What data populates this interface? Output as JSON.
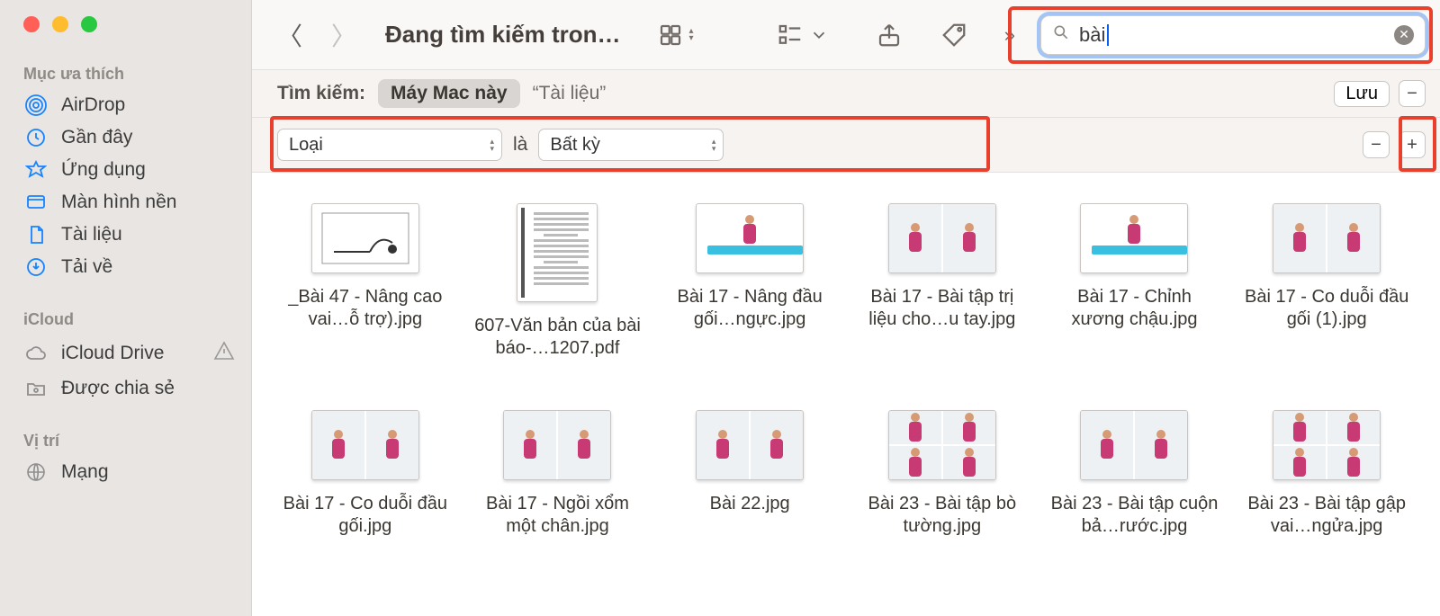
{
  "sidebar": {
    "sections": {
      "favorites": {
        "header": "Mục ưa thích",
        "items": [
          {
            "label": "AirDrop"
          },
          {
            "label": "Gần đây"
          },
          {
            "label": "Ứng dụng"
          },
          {
            "label": "Màn hình nền"
          },
          {
            "label": "Tài liệu"
          },
          {
            "label": "Tải về"
          }
        ]
      },
      "icloud": {
        "header": "iCloud",
        "items": [
          {
            "label": "iCloud Drive"
          },
          {
            "label": "Được chia sẻ"
          }
        ]
      },
      "locations": {
        "header": "Vị trí",
        "items": [
          {
            "label": "Mạng"
          }
        ]
      }
    }
  },
  "toolbar": {
    "title": "Đang tìm kiếm tron…",
    "search_value": "bài"
  },
  "scope": {
    "label": "Tìm kiếm:",
    "selected": "Máy Mac này",
    "alt": "“Tài liệu”",
    "save": "Lưu"
  },
  "criteria": {
    "kind_label": "Loại",
    "is_label": "là",
    "value_label": "Bất kỳ"
  },
  "files": [
    {
      "name": "_Bài 47 - Nâng cao vai…ỗ trợ).jpg",
      "thumb": "sketch"
    },
    {
      "name": "607-Văn bản của bài báo-…1207.pdf",
      "thumb": "doc"
    },
    {
      "name": "Bài 17 -  Nâng đầu gối…ngực.jpg",
      "thumb": "mat"
    },
    {
      "name": "Bài 17 - Bài tập trị liệu cho…u tay.jpg",
      "thumb": "two"
    },
    {
      "name": "Bài 17 - Chỉnh xương chậu.jpg",
      "thumb": "mat"
    },
    {
      "name": "Bài 17 - Co duỗi đầu gối (1).jpg",
      "thumb": "two"
    },
    {
      "name": "Bài 17 - Co duỗi đầu gối.jpg",
      "thumb": "two"
    },
    {
      "name": "Bài 17 - Ngồi xổm một chân.jpg",
      "thumb": "two"
    },
    {
      "name": "Bài 22.jpg",
      "thumb": "two"
    },
    {
      "name": "Bài 23 - Bài tập bò tường.jpg",
      "thumb": "four"
    },
    {
      "name": "Bài 23 - Bài tập cuộn bả…rước.jpg",
      "thumb": "two"
    },
    {
      "name": "Bài 23 - Bài tập gập vai…ngửa.jpg",
      "thumb": "four"
    }
  ]
}
